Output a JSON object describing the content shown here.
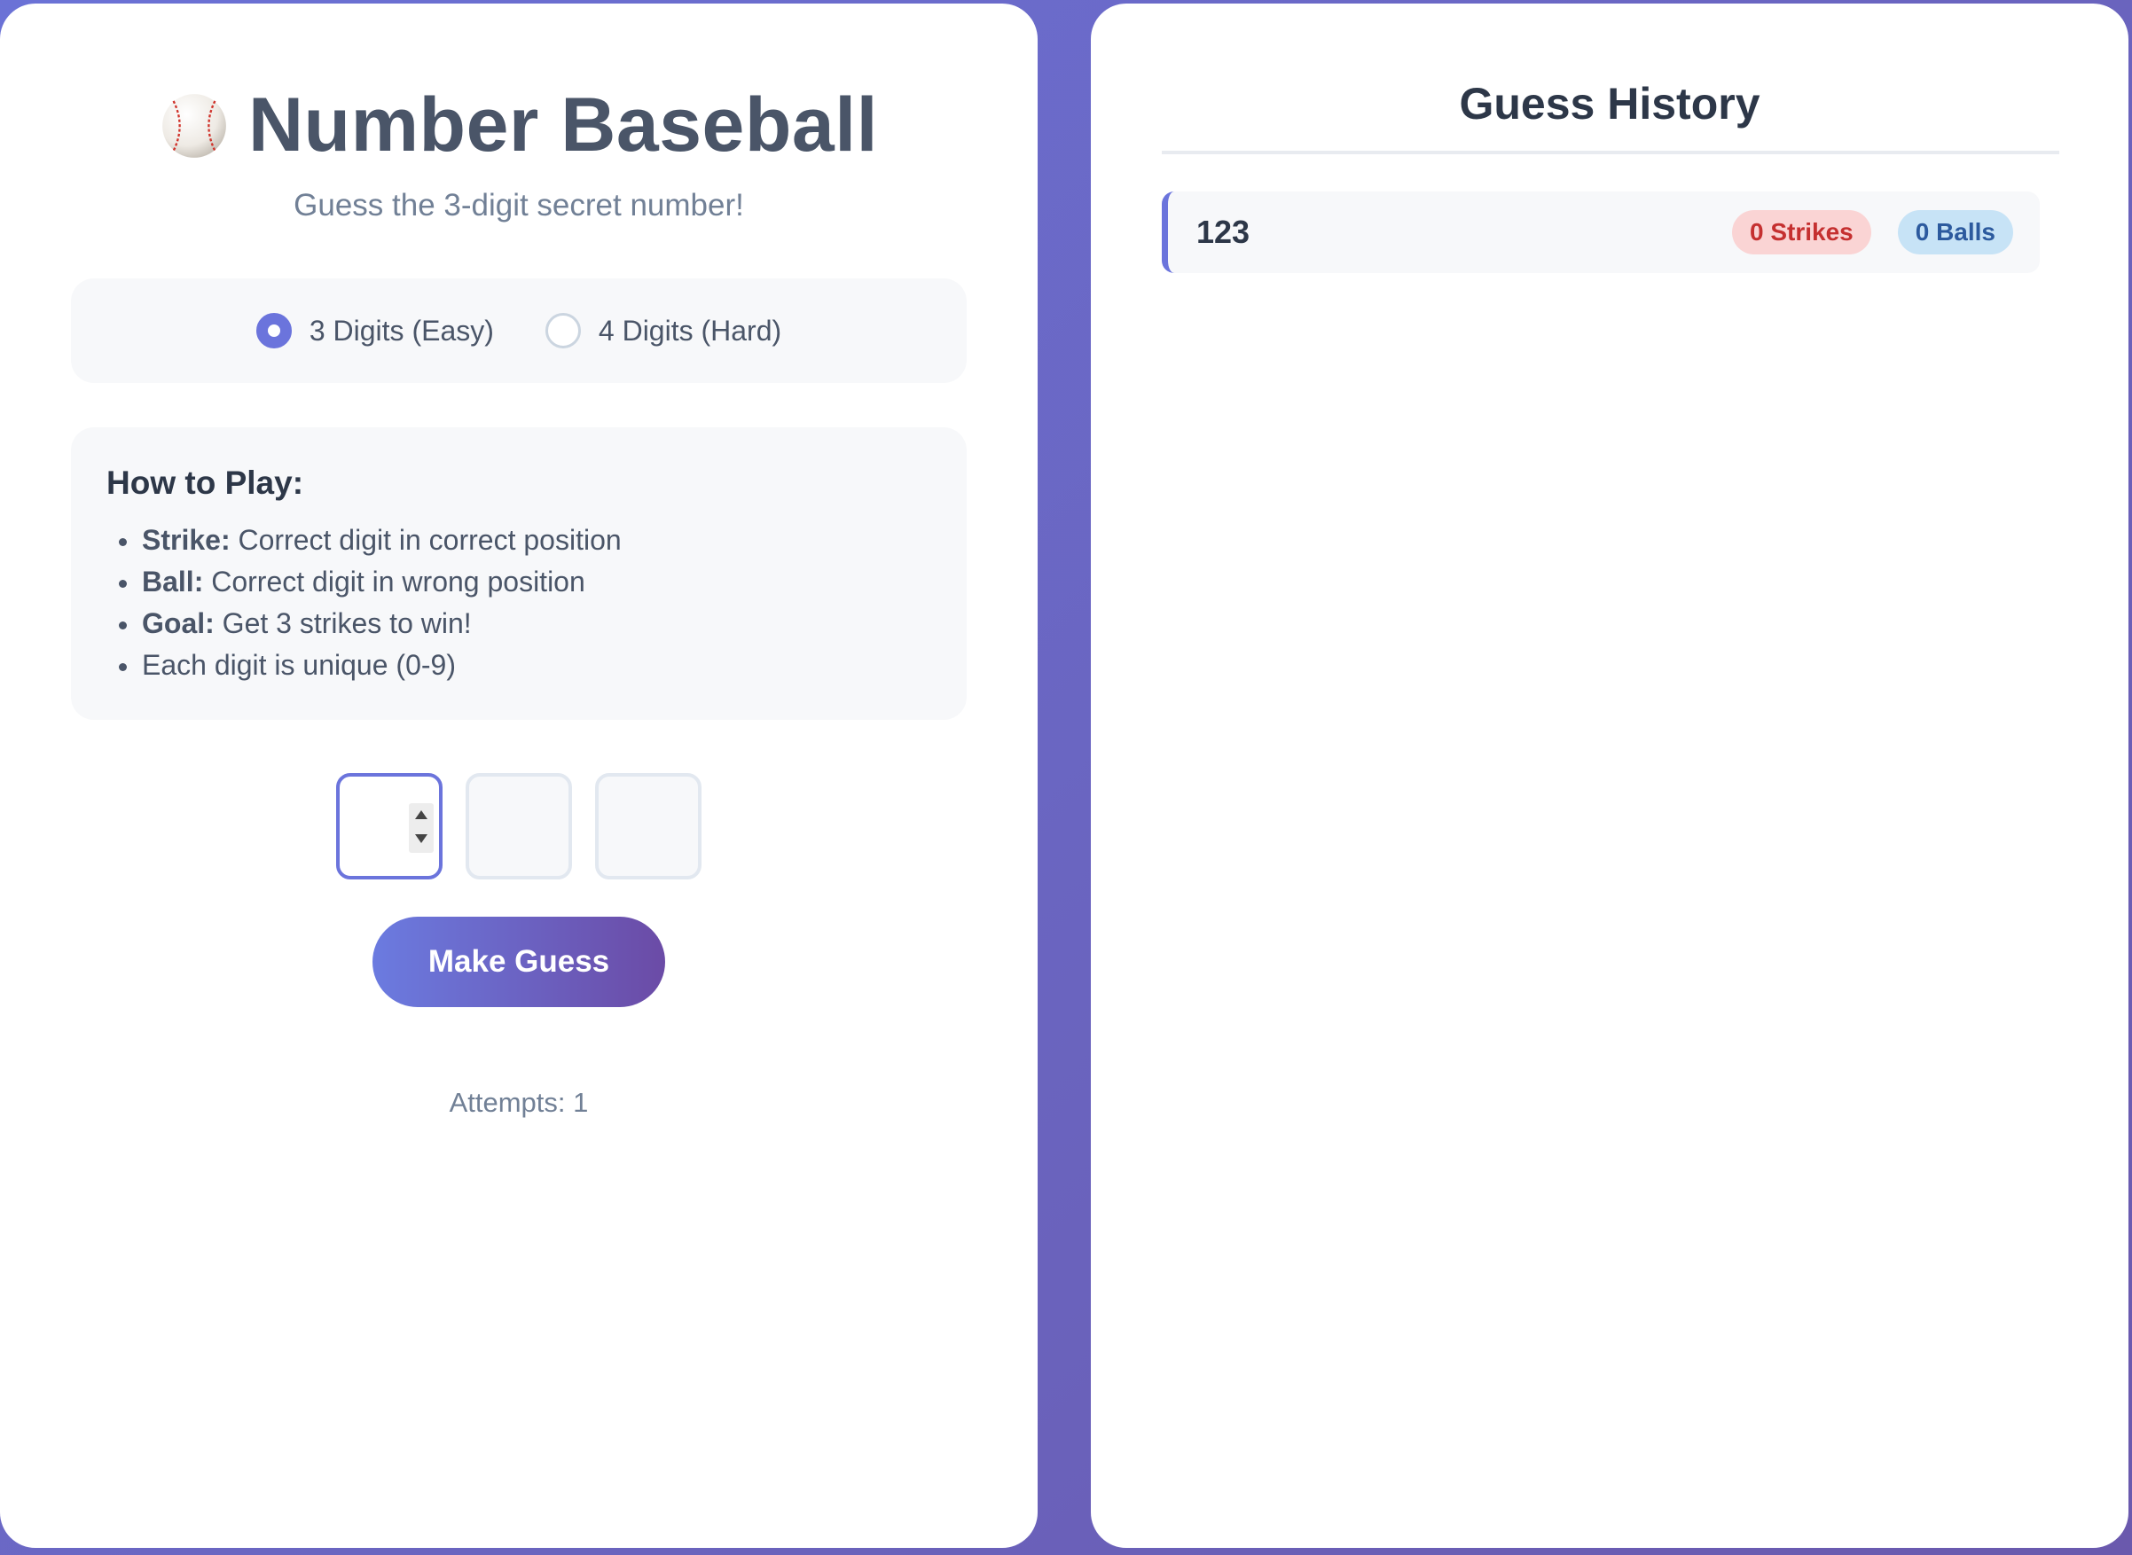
{
  "game": {
    "title": "Number Baseball",
    "title_icon": "baseball-icon",
    "subtitle": "Guess the 3-digit secret number!",
    "modes": [
      {
        "label": "3 Digits (Easy)",
        "selected": true
      },
      {
        "label": "4 Digits (Hard)",
        "selected": false
      }
    ],
    "rules": {
      "heading": "How to Play:",
      "items": [
        {
          "term": "Strike:",
          "text": " Correct digit in correct position"
        },
        {
          "term": "Ball:",
          "text": " Correct digit in wrong position"
        },
        {
          "term": "Goal:",
          "text": " Get 3 strikes to win!"
        },
        {
          "term": "",
          "text": "Each digit is unique (0-9)"
        }
      ]
    },
    "digits": [
      "",
      "",
      ""
    ],
    "guess_button_label": "Make Guess",
    "attempts_text": "Attempts: 1"
  },
  "history": {
    "title": "Guess History",
    "entries": [
      {
        "guess": "123",
        "strikes_label": "0 Strikes",
        "balls_label": "0 Balls"
      }
    ]
  },
  "colors": {
    "accent": "#6b74dc",
    "background_start": "#6b72d6",
    "background_end": "#6a59ad",
    "strike_badge": "#fad4d4",
    "ball_badge": "#c7e3f6"
  }
}
